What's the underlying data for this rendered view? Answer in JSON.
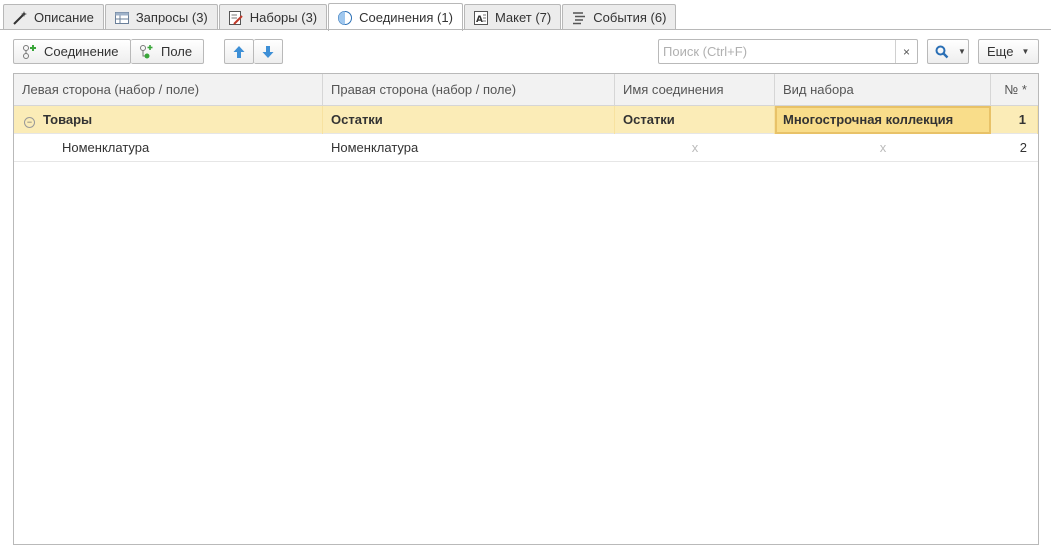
{
  "tabs": [
    {
      "label": "Описание",
      "icon": "magic-wand-icon",
      "active": false
    },
    {
      "label": "Запросы (3)",
      "icon": "table-query-icon",
      "active": false
    },
    {
      "label": "Наборы (3)",
      "icon": "dataset-edit-icon",
      "active": false
    },
    {
      "label": "Соединения (1)",
      "icon": "half-circle-icon",
      "active": true
    },
    {
      "label": "Макет (7)",
      "icon": "layout-icon",
      "active": false
    },
    {
      "label": "События (6)",
      "icon": "events-list-icon",
      "active": false
    }
  ],
  "toolbar": {
    "add_connection_label": "Соединение",
    "add_field_label": "Поле",
    "search_placeholder": "Поиск (Ctrl+F)",
    "search_clear_glyph": "×",
    "more_label": "Еще"
  },
  "table": {
    "columns": [
      "Левая сторона (набор / поле)",
      "Правая сторона (набор / поле)",
      "Имя соединения",
      "Вид набора",
      "№ *"
    ],
    "rows": [
      {
        "left": "Товары",
        "right": "Остатки",
        "name": "Остатки",
        "kind": "Многострочная коллекция",
        "num": "1"
      },
      {
        "left": "Номенклатура",
        "right": "Номенклатура",
        "name": "x",
        "kind": "x",
        "num": "2"
      }
    ]
  },
  "colors": {
    "selected_row": "#fbecb7",
    "focused_cell": "#f9dd8a",
    "icon_blue": "#3d8fd6",
    "icon_green": "#3aa63a"
  }
}
